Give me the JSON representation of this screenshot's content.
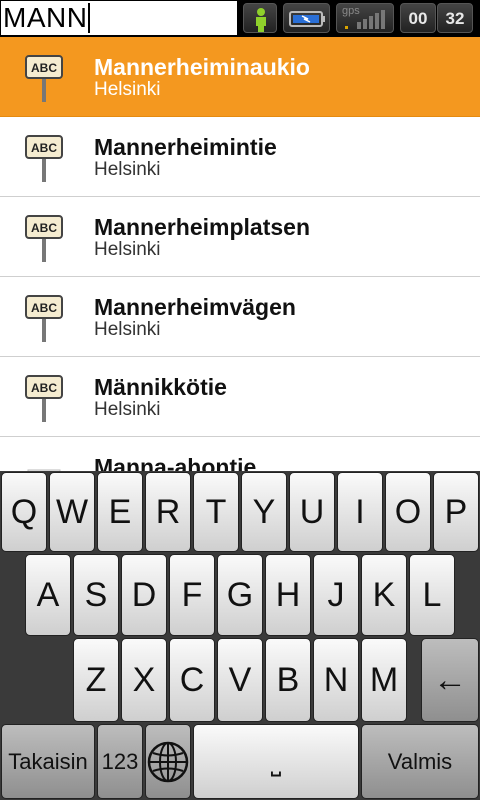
{
  "search": {
    "value": "MANN"
  },
  "status": {
    "gps_label": "gps",
    "time_hours": "00",
    "time_minutes": "32"
  },
  "results": [
    {
      "name": "Mannerheiminaukio",
      "city": "Helsinki",
      "icon": "street-sign-icon",
      "selected": true
    },
    {
      "name": "Mannerheimintie",
      "city": "Helsinki",
      "icon": "street-sign-icon"
    },
    {
      "name": "Mannerheimplatsen",
      "city": "Helsinki",
      "icon": "street-sign-icon"
    },
    {
      "name": "Mannerheimvägen",
      "city": "Helsinki",
      "icon": "street-sign-icon"
    },
    {
      "name": "Männikkötie",
      "city": "Helsinki",
      "icon": "street-sign-icon"
    },
    {
      "name": "Manna-ahontie",
      "city": "",
      "icon": "poi-icon"
    }
  ],
  "sign_text": "ABC",
  "keyboard": {
    "row1": [
      "Q",
      "W",
      "E",
      "R",
      "T",
      "Y",
      "U",
      "I",
      "O",
      "P"
    ],
    "row2": [
      "A",
      "S",
      "D",
      "F",
      "G",
      "H",
      "J",
      "K",
      "L"
    ],
    "row3": [
      "Z",
      "X",
      "C",
      "V",
      "B",
      "N",
      "M"
    ],
    "backspace": "←",
    "back_label": "Takaisin",
    "numbers_label": "123",
    "globe_icon": "globe-icon",
    "space_label": "⎵",
    "done_label": "Valmis"
  },
  "colors": {
    "selected": "#f4981f",
    "accent_green": "#8fd12b"
  }
}
